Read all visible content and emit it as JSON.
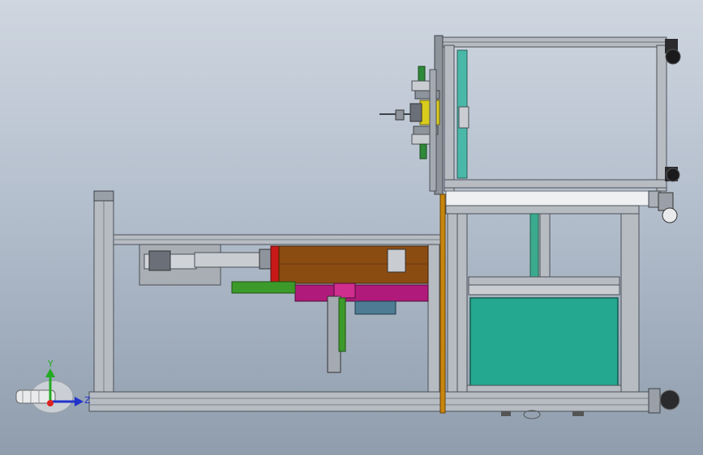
{
  "view": {
    "background_top": "#cfd6e0",
    "background_bottom": "#8f9dad"
  },
  "triad": {
    "y_label": "Y",
    "z_label": "Z",
    "y_color": "#22aa22",
    "z_color": "#2233cc",
    "x_color": "#dd2222"
  },
  "colors": {
    "frame_aluminum": "#b7bcc3",
    "frame_edge": "#4b5058",
    "brown_block": "#8b4c12",
    "teal_panel": "#24a88f",
    "magenta_part": "#b01a7a",
    "green_bar": "#3c9a2a",
    "yellow_part": "#d8cc1c",
    "orange_strip": "#c8860c",
    "red_plate": "#c81818"
  }
}
